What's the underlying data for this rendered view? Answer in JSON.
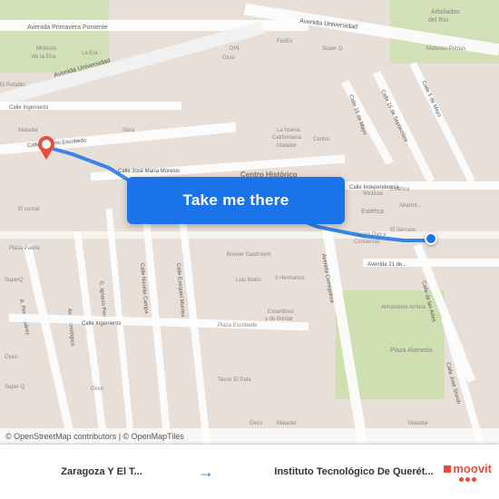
{
  "map": {
    "attribution": "© OpenStreetMap contributors | © OpenMapTiles",
    "button_label": "Take me there",
    "dest_pin_color": "#1a73e8",
    "origin_pin_color": "#e84c3d"
  },
  "bottom_bar": {
    "from_label": "Zaragoza Y El T...",
    "to_label": "Instituto Tecnológico De Querét...",
    "arrow": "→",
    "moovit": "moovit"
  }
}
